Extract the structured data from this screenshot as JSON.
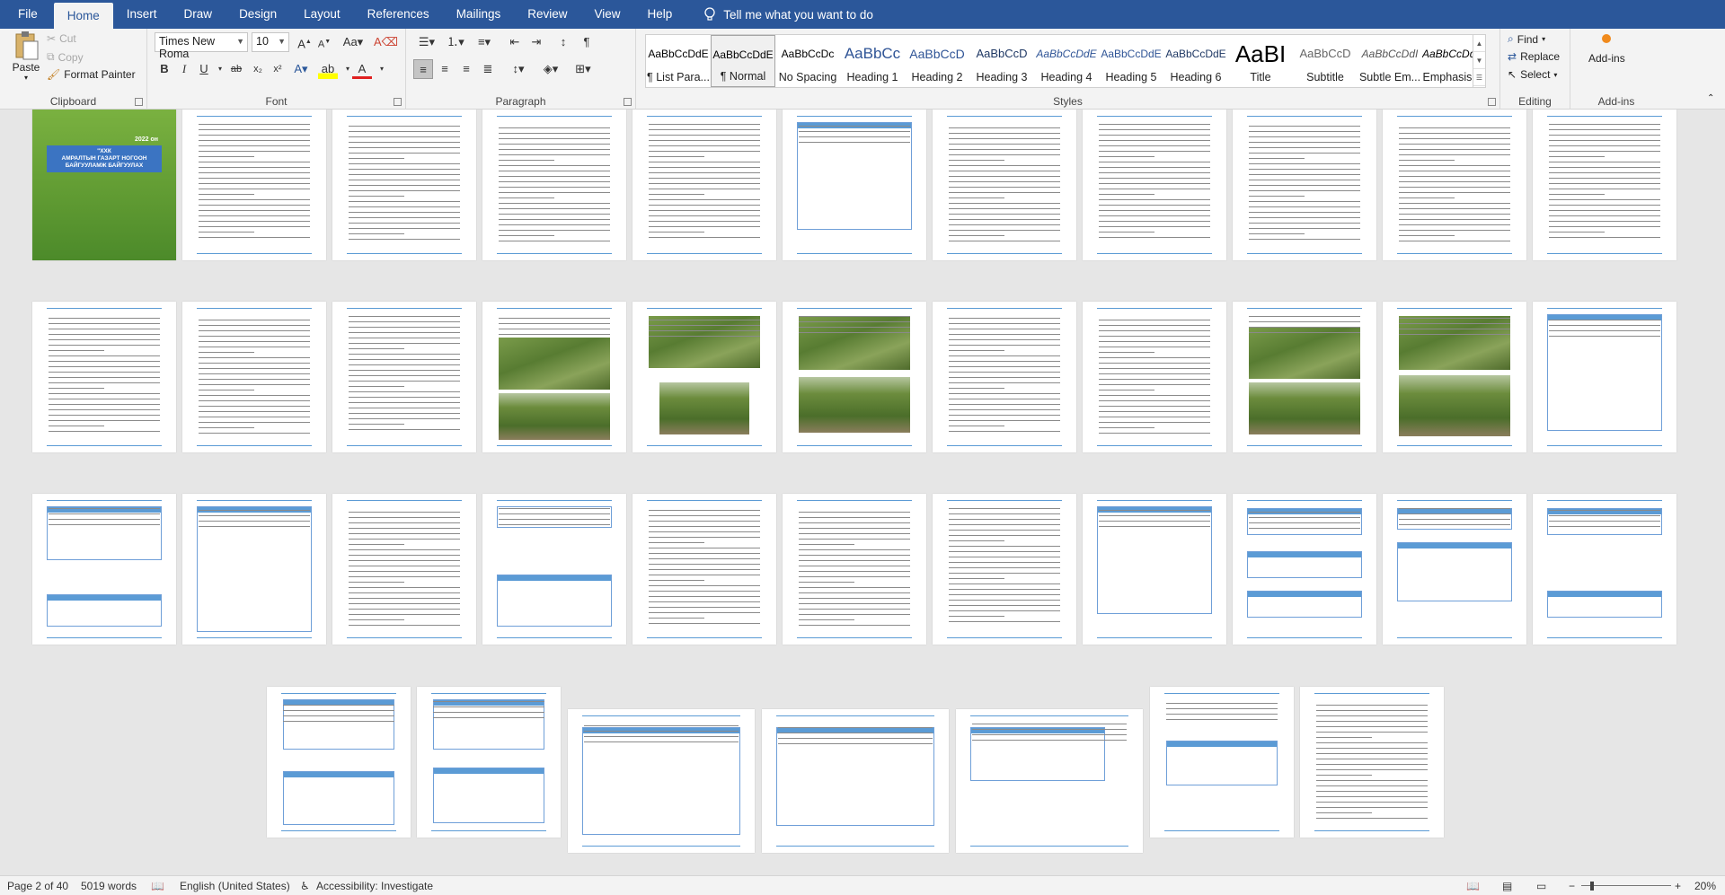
{
  "ribbon": {
    "tabs": [
      "File",
      "Home",
      "Insert",
      "Draw",
      "Design",
      "Layout",
      "References",
      "Mailings",
      "Review",
      "View",
      "Help"
    ],
    "active_tab": "Home",
    "tell_me": "Tell me what you want to do",
    "clipboard": {
      "paste": "Paste",
      "cut": "Cut",
      "copy": "Copy",
      "format_painter": "Format Painter",
      "label": "Clipboard"
    },
    "font": {
      "name": "Times New Roma",
      "size": "10",
      "label": "Font"
    },
    "paragraph": {
      "label": "Paragraph"
    },
    "styles": {
      "label": "Styles",
      "items": [
        {
          "sample": "AaBbCcDdE",
          "name": "¶ List Para..."
        },
        {
          "sample": "AaBbCcDdE",
          "name": "¶ Normal"
        },
        {
          "sample": "AaBbCcDc",
          "name": "No Spacing"
        },
        {
          "sample": "AaBbCc",
          "name": "Heading 1"
        },
        {
          "sample": "AaBbCcD",
          "name": "Heading 2"
        },
        {
          "sample": "AaBbCcD",
          "name": "Heading 3"
        },
        {
          "sample": "AaBbCcDdE",
          "name": "Heading 4"
        },
        {
          "sample": "AaBbCcDdE",
          "name": "Heading 5"
        },
        {
          "sample": "AaBbCcDdE",
          "name": "Heading 6"
        },
        {
          "sample": "AaBI",
          "name": "Title"
        },
        {
          "sample": "AaBbCcD",
          "name": "Subtitle"
        },
        {
          "sample": "AaBbCcDdI",
          "name": "Subtle Em..."
        },
        {
          "sample": "AaBbCcDdI",
          "name": "Emphasis"
        }
      ]
    },
    "editing": {
      "find": "Find",
      "replace": "Replace",
      "select": "Select",
      "label": "Editing"
    },
    "addins": {
      "button": "Add-ins",
      "label": "Add-ins"
    }
  },
  "document": {
    "cover_year": "2022 он",
    "cover_title": "АМРАЛТЫН ГАЗАРТ НОГООН БАЙГУУЛАМЖ БАЙГУУЛАХ",
    "cover_prefix": "\"ХХК"
  },
  "status": {
    "page": "Page 2 of 40",
    "words": "5019 words",
    "language": "English (United States)",
    "accessibility": "Accessibility: Investigate",
    "zoom": "20%"
  },
  "colors": {
    "ribbon_blue": "#2b579a",
    "accent": "#5b9bd5"
  }
}
